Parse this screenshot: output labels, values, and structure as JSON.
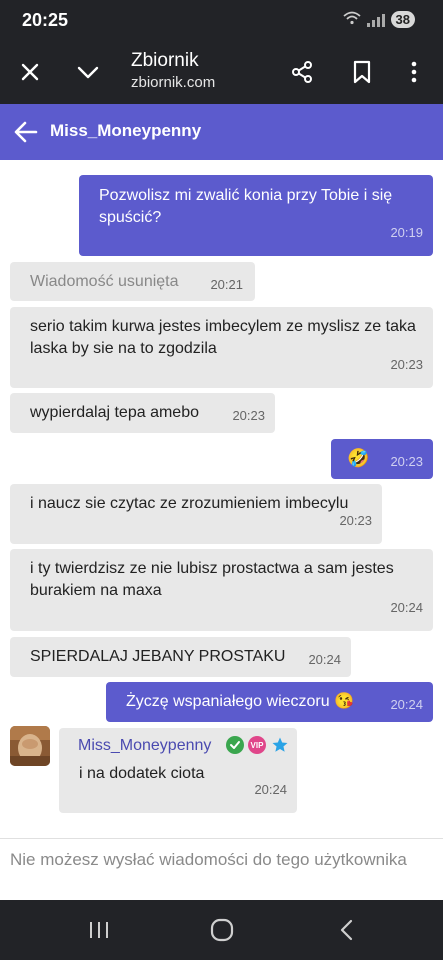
{
  "status_bar": {
    "time": "20:25",
    "battery": "38",
    "icons": [
      "wifi-icon",
      "signal-icon",
      "battery-icon"
    ]
  },
  "browser": {
    "title": "Zbiornik",
    "url": "zbiornik.com",
    "icons": [
      "close-icon",
      "chevron-down-icon",
      "share-icon",
      "bookmark-icon",
      "more-vert-icon"
    ]
  },
  "chat_header": {
    "contact_name": "Miss_Moneypenny"
  },
  "messages": [
    {
      "direction": "out",
      "text": "Pozwolisz mi zwalić konia przy Tobie i się spuścić?",
      "time": "20:19"
    },
    {
      "direction": "in",
      "text": "Wiadomość usunięta",
      "time": "20:21",
      "deleted": true
    },
    {
      "direction": "in",
      "text": "serio takim kurwa jestes imbecylem ze myslisz ze taka laska by sie na to zgodzila",
      "time": "20:23"
    },
    {
      "direction": "in",
      "text": "wypierdalaj tepa amebo",
      "time": "20:23"
    },
    {
      "direction": "out",
      "text": "🤣",
      "time": "20:23"
    },
    {
      "direction": "in",
      "text": "i naucz sie czytac ze zrozumieniem imbecylu",
      "time": "20:23"
    },
    {
      "direction": "in",
      "text": "i ty twierdzisz ze nie lubisz prostactwa a sam jestes burakiem na maxa",
      "time": "20:24"
    },
    {
      "direction": "in",
      "text": "SPIERDALAJ JEBANY PROSTAKU",
      "time": "20:24"
    },
    {
      "direction": "out",
      "text": "Życzę wspaniałego wieczoru 😘",
      "time": "20:24"
    },
    {
      "direction": "in",
      "sender": "Miss_Moneypenny",
      "text": "i na dodatek ciota",
      "time": "20:24",
      "badges": [
        "verified",
        "VIP",
        "star"
      ]
    }
  ],
  "footer": {
    "notice": "Nie możesz wysłać wiadomości do tego użytkownika"
  },
  "colors": {
    "accent": "#5c5bcd",
    "incoming_bubble": "#e8e8e8",
    "bar": "#222327"
  }
}
